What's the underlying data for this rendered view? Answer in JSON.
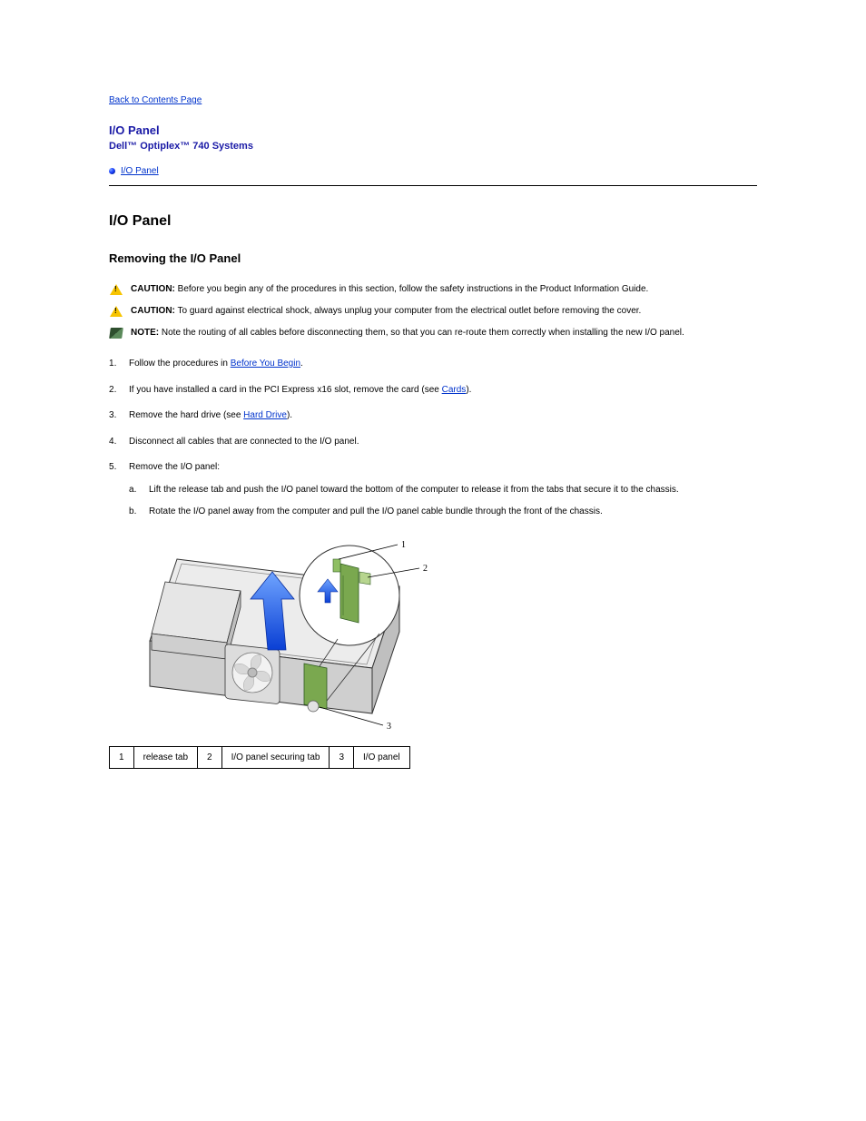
{
  "nav": {
    "back": "Back to Contents Page"
  },
  "header": {
    "title": "I/O Panel",
    "subtitle": "Dell™ Optiplex™ 740 Systems"
  },
  "toc": {
    "items": [
      {
        "label": "I/O Panel"
      }
    ]
  },
  "section": {
    "heading": "I/O Panel",
    "subheading": "Removing the I/O Panel"
  },
  "notices": {
    "caution_label": "CAUTION:",
    "caution1": "Before you begin any of the procedures in this section, follow the safety instructions in the Product Information Guide.",
    "caution2": "To guard against electrical shock, always unplug your computer from the electrical outlet before removing the cover.",
    "note_label": "NOTE:",
    "note": "Note the routing of all cables before disconnecting them, so that you can re-route them correctly when installing the new I/O panel."
  },
  "links": {
    "before_you_begin": "Before You Begin",
    "cards": "Cards",
    "hard_drive": "Hard Drive"
  },
  "steps": {
    "s1_a": "Follow the procedures in ",
    "s1_b": ".",
    "s2_a": "If you have installed a card in the PCI Express x16 slot, remove the card (see ",
    "s2_b": ").",
    "s3_a": "Remove the hard drive (see ",
    "s3_b": ").",
    "s4": "Disconnect all cables that are connected to the I/O panel.",
    "s5": "Remove the I/O panel:",
    "s5a": "Lift the release tab and push the I/O panel toward the bottom of the computer to release it from the tabs that secure it to the chassis.",
    "s5b": "Rotate the I/O panel away from the computer and pull the I/O panel cable bundle through the front of the chassis."
  },
  "labels": {
    "c1n": "1",
    "c1t": "release tab",
    "c2n": "2",
    "c2t": "I/O panel securing tab",
    "c3n": "3",
    "c3t": "I/O panel"
  }
}
